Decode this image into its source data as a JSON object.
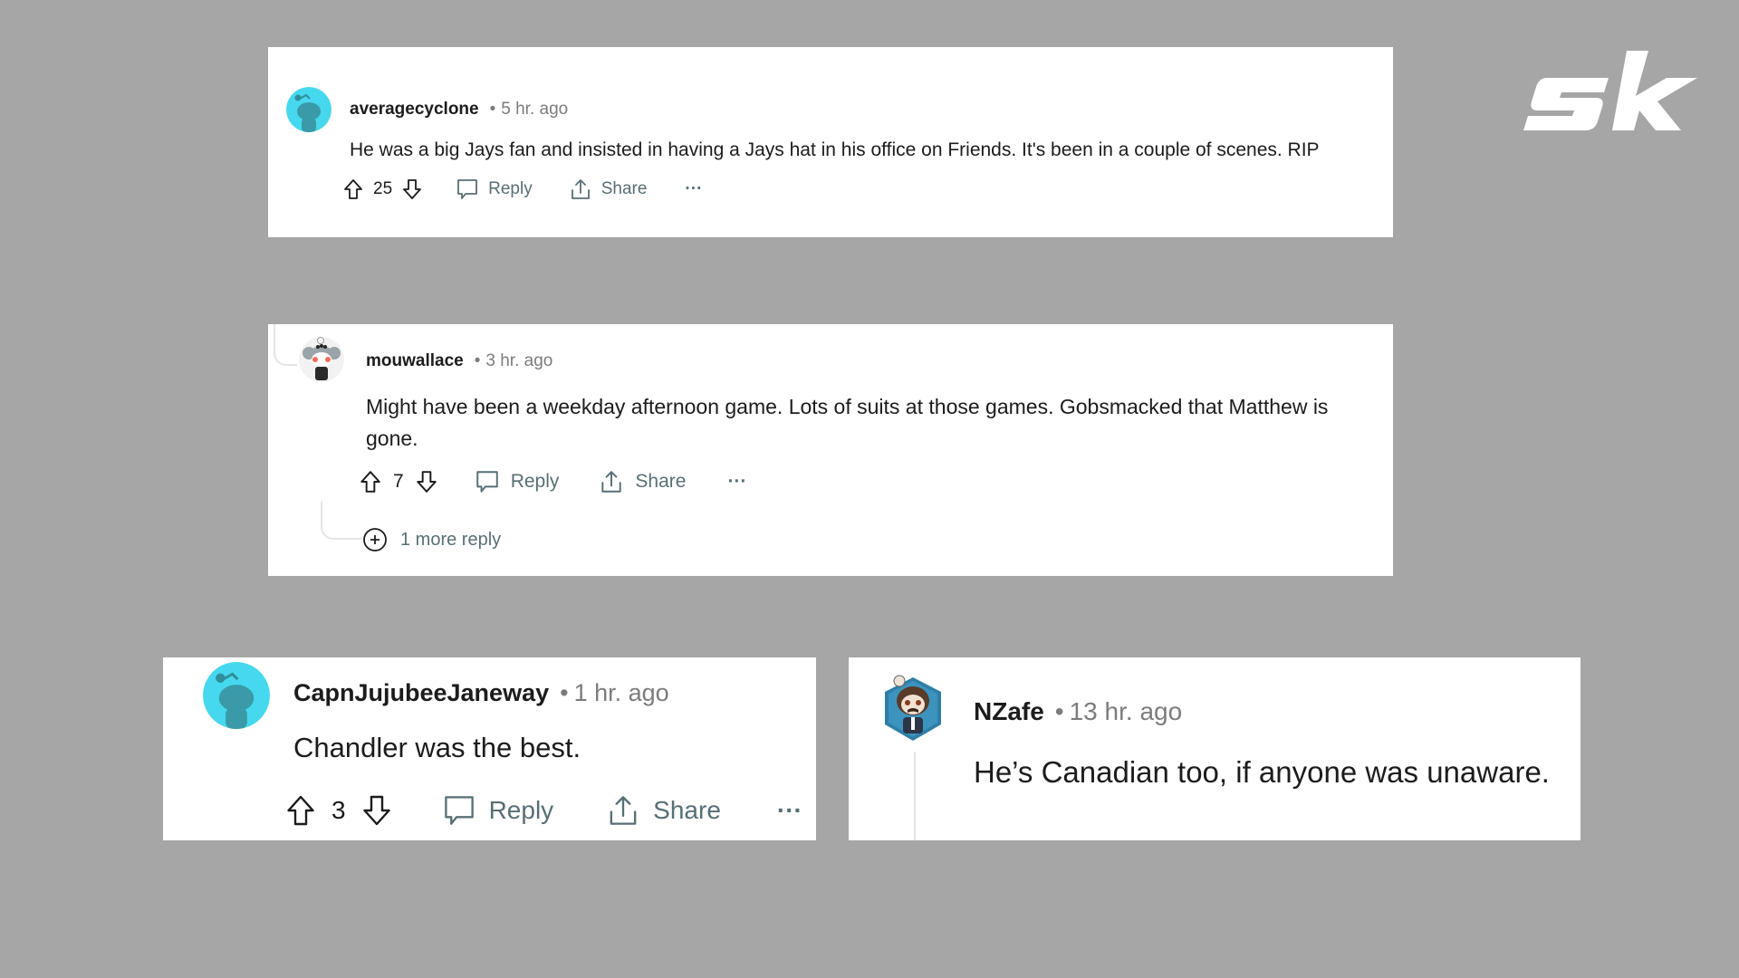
{
  "brand": {
    "logo_text": "sk",
    "logo_color": "#ffffff"
  },
  "colors": {
    "background": "#a6a6a6",
    "card": "#ffffff",
    "muted": "#576f76",
    "avatar_teal": "#46d8ee"
  },
  "comments": [
    {
      "username": "averagecyclone",
      "separator": "•",
      "time": "5 hr. ago",
      "body": "He was a big Jays fan and insisted in having a Jays hat in his office on Friends. It's been in a couple of scenes. RIP",
      "score": "25",
      "reply_label": "Reply",
      "share_label": "Share",
      "more_label": "···",
      "avatar": "snoo-teal-avatar"
    },
    {
      "username": "mouwallace",
      "separator": "•",
      "time": "3 hr. ago",
      "body": "Might have been a weekday afternoon game. Lots of suits at those games. Gobsmacked that Matthew is gone.",
      "score": "7",
      "reply_label": "Reply",
      "share_label": "Share",
      "more_label": "···",
      "more_replies": "1 more reply",
      "avatar": "koala-snoo-avatar"
    },
    {
      "username": "CapnJujubeeJaneway",
      "separator": "•",
      "time": "1 hr. ago",
      "body": "Chandler was the best.",
      "score": "3",
      "reply_label": "Reply",
      "share_label": "Share",
      "more_label": "···",
      "avatar": "snoo-teal-avatar"
    },
    {
      "username": "NZafe",
      "separator": "•",
      "time": "13 hr. ago",
      "body": "He’s Canadian too, if anyone was unaware.",
      "avatar": "mustache-snoo-avatar"
    }
  ]
}
